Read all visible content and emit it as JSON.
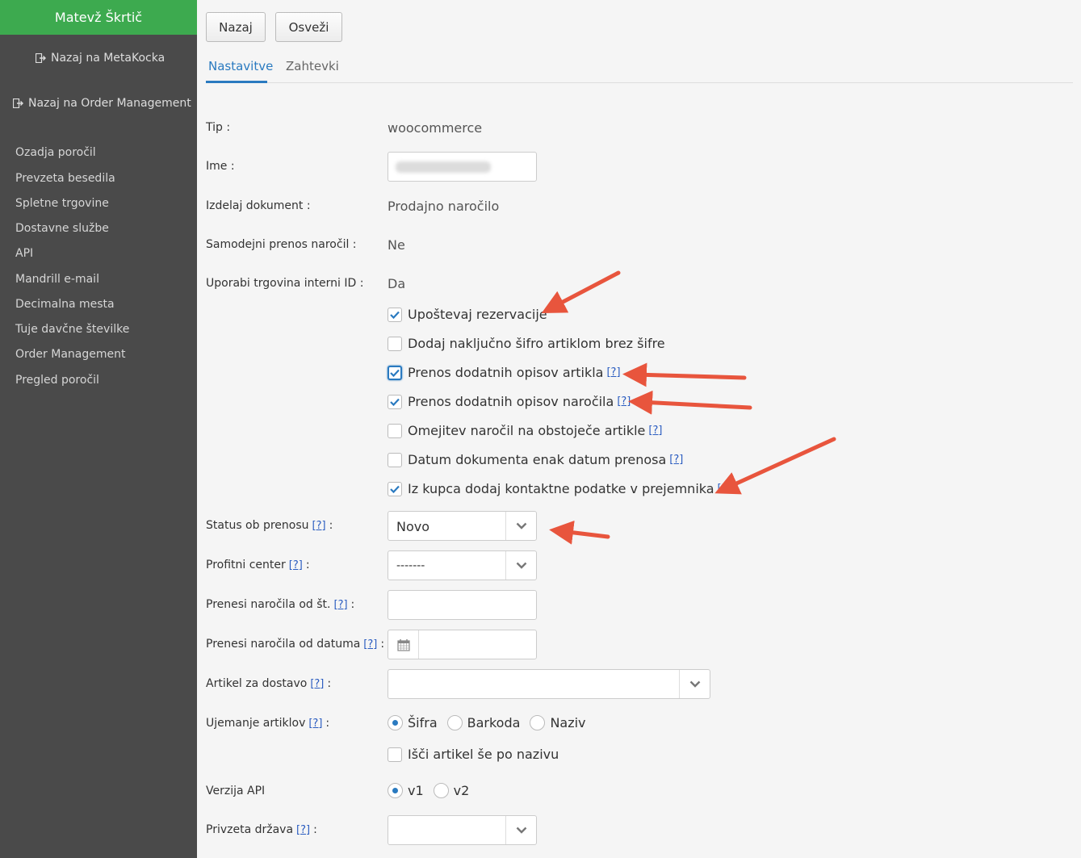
{
  "sidebar": {
    "user_name": "Matevž Škrtič",
    "back_metakocka": "Nazaj na MetaKocka",
    "back_order_management": "Nazaj na Order Management",
    "items": [
      "Ozadja poročil",
      "Prevzeta besedila",
      "Spletne trgovine",
      "Dostavne službe",
      "API",
      "Mandrill e-mail",
      "Decimalna mesta",
      "Tuje davčne številke",
      "Order Management",
      "Pregled poročil"
    ]
  },
  "toolbar": {
    "back_label": "Nazaj",
    "refresh_label": "Osveži"
  },
  "tabs": {
    "settings": "Nastavitve",
    "requests": "Zahtevki"
  },
  "help_text": "[?]",
  "form": {
    "type_label": "Tip :",
    "type_value": "woocommerce",
    "name_label": "Ime :",
    "doc_label": "Izdelaj dokument :",
    "doc_value": "Prodajno naročilo",
    "auto_label": "Samodejni prenos naročil :",
    "auto_value": "Ne",
    "internal_id_label": "Uporabi trgovina interni ID :",
    "internal_id_value": "Da",
    "checkboxes": [
      {
        "label": "Upoštevaj rezervacije",
        "checked": true
      },
      {
        "label": "Dodaj naključno šifro artiklom brez šifre",
        "checked": false
      },
      {
        "label": "Prenos dodatnih opisov artikla",
        "checked": true
      },
      {
        "label": "Prenos dodatnih opisov naročila",
        "checked": true
      },
      {
        "label": "Omejitev naročil na obstoječe artikle",
        "checked": false
      },
      {
        "label": "Datum dokumenta enak datum prenosa",
        "checked": false
      },
      {
        "label": "Iz kupca dodaj kontaktne podatke v prejemnika",
        "checked": true
      }
    ],
    "status_label": "Status ob prenosu",
    "status_value": "Novo",
    "profit_label": "Profitni center",
    "profit_value": "-------",
    "from_no_label": "Prenesi naročila od št.",
    "from_date_label": "Prenesi naročila od datuma",
    "delivery_label": "Artikel za dostavo",
    "matching_label": "Ujemanje artiklov",
    "matching_options": [
      "Šifra",
      "Barkoda",
      "Naziv"
    ],
    "matching_selected": "Šifra",
    "search_by_name_label": "Išči artikel še po nazivu",
    "api_label": "Verzija API",
    "api_options": [
      "v1",
      "v2"
    ],
    "api_selected": "v1",
    "country_label": "Privzeta država"
  },
  "colors": {
    "accent": "#2a7ac0",
    "brand_green": "#3daa4f",
    "sidebar": "#4a4a4a",
    "arrow": "#e8553d"
  }
}
